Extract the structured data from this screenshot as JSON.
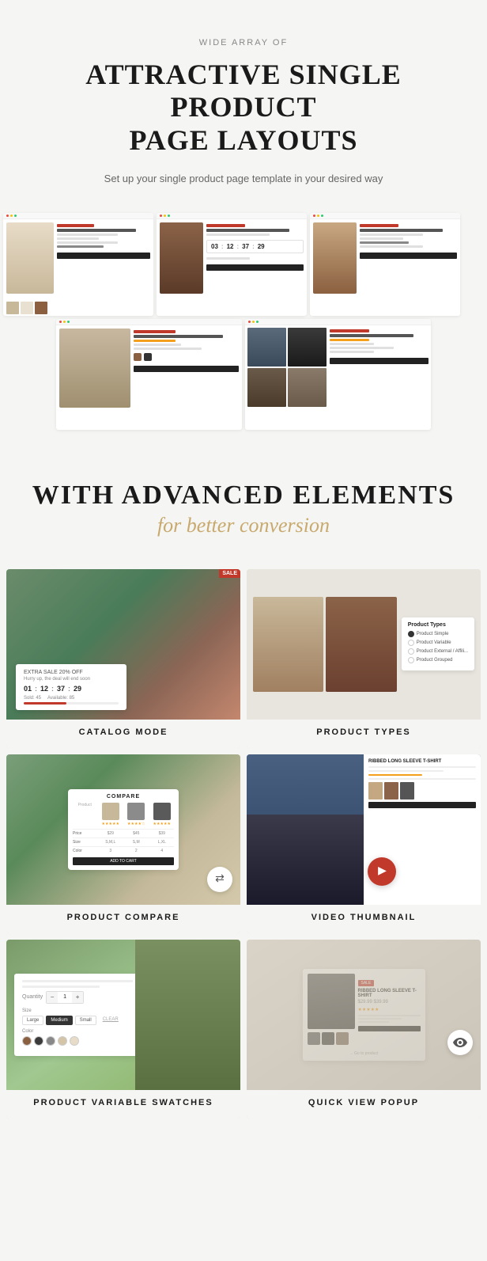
{
  "hero": {
    "sub_label": "WIDE ARRAY OF",
    "title_line1": "ATTRACTIVE SINGLE PRODUCT",
    "title_line2": "PAGE LAYOUTS",
    "description": "Set up your single product page template in your desired way"
  },
  "advanced": {
    "title": "WITH ADVANCED ELEMENTS",
    "subtitle": "for better conversion"
  },
  "features": [
    {
      "id": "catalog-mode",
      "label": "CATALOG MODE",
      "badge": "SALE",
      "extra": "EXTRA SALE 20% OFF",
      "hurry": "Hurry up, the deal will end soon",
      "timer": {
        "h": "01",
        "m": "12",
        "s": "37",
        "ms": "29"
      },
      "sold": "Sold: 45",
      "avail": "Available: 85"
    },
    {
      "id": "product-types",
      "label": "PRODUCT TYPES",
      "menu_title": "Product Types",
      "items": [
        "Product Simple",
        "Product Variable",
        "Product External / Affili...",
        "Product Grouped"
      ]
    },
    {
      "id": "product-compare",
      "label": "PRODUCT COMPARE",
      "table_title": "COMPARE"
    },
    {
      "id": "video-thumbnail",
      "label": "VIDEO THUMBNAIL"
    },
    {
      "id": "product-swatches",
      "label": "PRODUCT VARIABLE SWATCHES",
      "qty_label": "Quantity",
      "size_label": "Size",
      "sizes": [
        "Large",
        "Medium",
        "Small",
        "CLEAR"
      ],
      "color_label": "Color"
    },
    {
      "id": "quick-view",
      "label": "QUICK VIEW POPUP",
      "product_badge": "SALE",
      "product_title": "RIBBED LONG SLEEVE T-SHIRT",
      "product_price": "$29.99 $39.99"
    }
  ],
  "screenshots": {
    "row1": [
      "Layout 1 - sidebar thumbnails",
      "Layout 2 - countdown",
      "Layout 3 - skirt"
    ],
    "row2": [
      "Layout 4 - halter top",
      "Layout 5 - model gallery"
    ]
  }
}
